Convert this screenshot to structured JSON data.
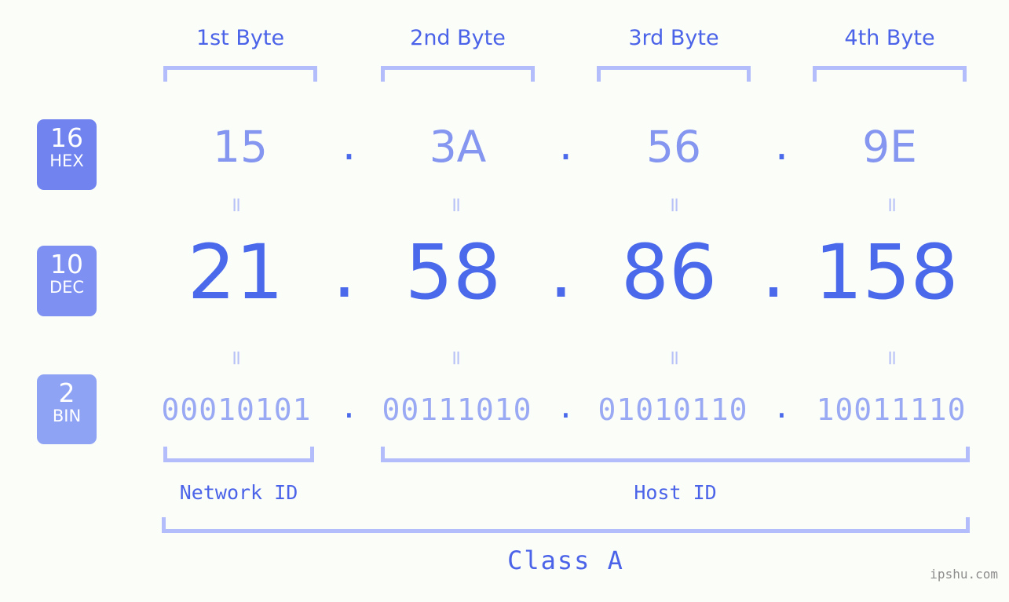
{
  "colors": {
    "background": "#fbfdf8",
    "accent_strong": "#4a69eb",
    "accent_mid": "#8596f0",
    "accent_light": "#b3bdfb",
    "badge_hex": "#7083ef",
    "badge_dec": "#7e91f2",
    "badge_bin": "#8fa3f5",
    "watermark": "#8d8d8d"
  },
  "byte_headers": [
    {
      "label": "1st Byte"
    },
    {
      "label": "2nd Byte"
    },
    {
      "label": "3rd Byte"
    },
    {
      "label": "4th Byte"
    }
  ],
  "rows": {
    "hex": {
      "badge_number": "16",
      "badge_name": "HEX",
      "values": [
        "15",
        "3A",
        "56",
        "9E"
      ],
      "separator": "."
    },
    "dec": {
      "badge_number": "10",
      "badge_name": "DEC",
      "values": [
        "21",
        "58",
        "86",
        "158"
      ],
      "separator": "."
    },
    "bin": {
      "badge_number": "2",
      "badge_name": "BIN",
      "values": [
        "00010101",
        "00111010",
        "01010110",
        "10011110"
      ],
      "separator": "."
    }
  },
  "equals_marks": {
    "glyph": "=",
    "hex_to_dec_count": 4,
    "dec_to_bin_count": 4
  },
  "id_sections": [
    {
      "label": "Network ID"
    },
    {
      "label": "Host ID"
    }
  ],
  "class_section": {
    "label": "Class A"
  },
  "watermark": {
    "text": "ipshu.com"
  },
  "chart_data": {
    "type": "table",
    "title": "IP address byte breakdown",
    "categories": [
      "1st Byte",
      "2nd Byte",
      "3rd Byte",
      "4th Byte"
    ],
    "series": [
      {
        "name": "HEX (base 16)",
        "values": [
          "15",
          "3A",
          "56",
          "9E"
        ]
      },
      {
        "name": "DEC (base 10)",
        "values": [
          "21",
          "58",
          "86",
          "158"
        ]
      },
      {
        "name": "BIN (base 2)",
        "values": [
          "00010101",
          "00111010",
          "01010110",
          "10011110"
        ]
      }
    ],
    "annotations": [
      "Network ID = 1st Byte",
      "Host ID = 2nd-4th Byte",
      "Class A"
    ]
  }
}
